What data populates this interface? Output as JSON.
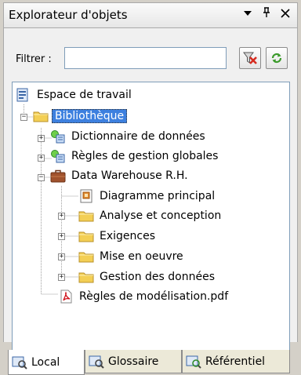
{
  "window": {
    "title": "Explorateur d'objets",
    "buttons": {
      "menu": "▼",
      "pin": "ᵖ",
      "close": "✕"
    }
  },
  "filter": {
    "label": "Filtrer :",
    "value": "",
    "clear_icon": "filter-clear-icon",
    "apply_icon": "filter-refresh-icon"
  },
  "tree": {
    "root": {
      "label": "Espace de travail",
      "icon": "workspace-icon"
    },
    "library": {
      "label": "Bibliothèque",
      "icon": "folder-icon",
      "expanded": true,
      "selected": true
    },
    "dictionary": {
      "label": "Dictionnaire de données",
      "icon": "model-icon"
    },
    "rules": {
      "label": "Règles de gestion globales",
      "icon": "model-icon"
    },
    "warehouse": {
      "label": "Data Warehouse R.H.",
      "icon": "project-icon",
      "expanded": true
    },
    "diagram": {
      "label": "Diagramme principal",
      "icon": "diagram-icon"
    },
    "analysis": {
      "label": "Analyse et conception",
      "icon": "folder-icon"
    },
    "requirements": {
      "label": "Exigences",
      "icon": "folder-icon"
    },
    "implementation": {
      "label": "Mise en oeuvre",
      "icon": "folder-icon"
    },
    "datamgmt": {
      "label": "Gestion des données",
      "icon": "folder-icon"
    },
    "pdf": {
      "label": "Règles de modélisation.pdf",
      "icon": "pdf-icon"
    }
  },
  "tabs": [
    {
      "label": "Local",
      "icon": "local-icon",
      "active": true
    },
    {
      "label": "Glossaire",
      "icon": "glossary-icon",
      "active": false
    },
    {
      "label": "Référentiel",
      "icon": "repository-icon",
      "active": false
    }
  ]
}
